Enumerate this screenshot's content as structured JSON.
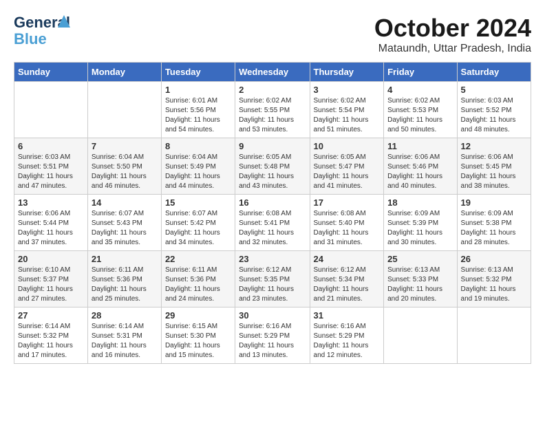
{
  "header": {
    "logo": {
      "line1": "General",
      "line2": "Blue"
    },
    "title": "October 2024",
    "subtitle": "Mataundh, Uttar Pradesh, India"
  },
  "weekdays": [
    "Sunday",
    "Monday",
    "Tuesday",
    "Wednesday",
    "Thursday",
    "Friday",
    "Saturday"
  ],
  "weeks": [
    [
      {
        "day": "",
        "info": ""
      },
      {
        "day": "",
        "info": ""
      },
      {
        "day": "1",
        "info": "Sunrise: 6:01 AM\nSunset: 5:56 PM\nDaylight: 11 hours and 54 minutes."
      },
      {
        "day": "2",
        "info": "Sunrise: 6:02 AM\nSunset: 5:55 PM\nDaylight: 11 hours and 53 minutes."
      },
      {
        "day": "3",
        "info": "Sunrise: 6:02 AM\nSunset: 5:54 PM\nDaylight: 11 hours and 51 minutes."
      },
      {
        "day": "4",
        "info": "Sunrise: 6:02 AM\nSunset: 5:53 PM\nDaylight: 11 hours and 50 minutes."
      },
      {
        "day": "5",
        "info": "Sunrise: 6:03 AM\nSunset: 5:52 PM\nDaylight: 11 hours and 48 minutes."
      }
    ],
    [
      {
        "day": "6",
        "info": "Sunrise: 6:03 AM\nSunset: 5:51 PM\nDaylight: 11 hours and 47 minutes."
      },
      {
        "day": "7",
        "info": "Sunrise: 6:04 AM\nSunset: 5:50 PM\nDaylight: 11 hours and 46 minutes."
      },
      {
        "day": "8",
        "info": "Sunrise: 6:04 AM\nSunset: 5:49 PM\nDaylight: 11 hours and 44 minutes."
      },
      {
        "day": "9",
        "info": "Sunrise: 6:05 AM\nSunset: 5:48 PM\nDaylight: 11 hours and 43 minutes."
      },
      {
        "day": "10",
        "info": "Sunrise: 6:05 AM\nSunset: 5:47 PM\nDaylight: 11 hours and 41 minutes."
      },
      {
        "day": "11",
        "info": "Sunrise: 6:06 AM\nSunset: 5:46 PM\nDaylight: 11 hours and 40 minutes."
      },
      {
        "day": "12",
        "info": "Sunrise: 6:06 AM\nSunset: 5:45 PM\nDaylight: 11 hours and 38 minutes."
      }
    ],
    [
      {
        "day": "13",
        "info": "Sunrise: 6:06 AM\nSunset: 5:44 PM\nDaylight: 11 hours and 37 minutes."
      },
      {
        "day": "14",
        "info": "Sunrise: 6:07 AM\nSunset: 5:43 PM\nDaylight: 11 hours and 35 minutes."
      },
      {
        "day": "15",
        "info": "Sunrise: 6:07 AM\nSunset: 5:42 PM\nDaylight: 11 hours and 34 minutes."
      },
      {
        "day": "16",
        "info": "Sunrise: 6:08 AM\nSunset: 5:41 PM\nDaylight: 11 hours and 32 minutes."
      },
      {
        "day": "17",
        "info": "Sunrise: 6:08 AM\nSunset: 5:40 PM\nDaylight: 11 hours and 31 minutes."
      },
      {
        "day": "18",
        "info": "Sunrise: 6:09 AM\nSunset: 5:39 PM\nDaylight: 11 hours and 30 minutes."
      },
      {
        "day": "19",
        "info": "Sunrise: 6:09 AM\nSunset: 5:38 PM\nDaylight: 11 hours and 28 minutes."
      }
    ],
    [
      {
        "day": "20",
        "info": "Sunrise: 6:10 AM\nSunset: 5:37 PM\nDaylight: 11 hours and 27 minutes."
      },
      {
        "day": "21",
        "info": "Sunrise: 6:11 AM\nSunset: 5:36 PM\nDaylight: 11 hours and 25 minutes."
      },
      {
        "day": "22",
        "info": "Sunrise: 6:11 AM\nSunset: 5:36 PM\nDaylight: 11 hours and 24 minutes."
      },
      {
        "day": "23",
        "info": "Sunrise: 6:12 AM\nSunset: 5:35 PM\nDaylight: 11 hours and 23 minutes."
      },
      {
        "day": "24",
        "info": "Sunrise: 6:12 AM\nSunset: 5:34 PM\nDaylight: 11 hours and 21 minutes."
      },
      {
        "day": "25",
        "info": "Sunrise: 6:13 AM\nSunset: 5:33 PM\nDaylight: 11 hours and 20 minutes."
      },
      {
        "day": "26",
        "info": "Sunrise: 6:13 AM\nSunset: 5:32 PM\nDaylight: 11 hours and 19 minutes."
      }
    ],
    [
      {
        "day": "27",
        "info": "Sunrise: 6:14 AM\nSunset: 5:32 PM\nDaylight: 11 hours and 17 minutes."
      },
      {
        "day": "28",
        "info": "Sunrise: 6:14 AM\nSunset: 5:31 PM\nDaylight: 11 hours and 16 minutes."
      },
      {
        "day": "29",
        "info": "Sunrise: 6:15 AM\nSunset: 5:30 PM\nDaylight: 11 hours and 15 minutes."
      },
      {
        "day": "30",
        "info": "Sunrise: 6:16 AM\nSunset: 5:29 PM\nDaylight: 11 hours and 13 minutes."
      },
      {
        "day": "31",
        "info": "Sunrise: 6:16 AM\nSunset: 5:29 PM\nDaylight: 11 hours and 12 minutes."
      },
      {
        "day": "",
        "info": ""
      },
      {
        "day": "",
        "info": ""
      }
    ]
  ]
}
